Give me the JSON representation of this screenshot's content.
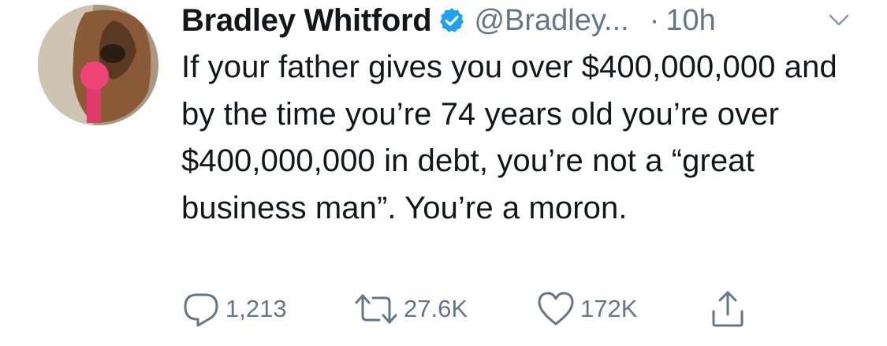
{
  "tweet": {
    "display_name": "Bradley Whitford",
    "handle": "@Bradley...",
    "dot": "·",
    "time": "10h",
    "text": "If your father gives you over $400,000,000 and by the time you’re 74 years old you’re over $400,000,000 in debt, you’re not a “great business man”. You’re a moron."
  },
  "actions": {
    "reply": {
      "icon": "reply-icon",
      "count": "1,213"
    },
    "retweet": {
      "icon": "retweet-icon",
      "count": "27.6K"
    },
    "like": {
      "icon": "heart-icon",
      "count": "172K"
    },
    "share": {
      "icon": "share-icon"
    }
  },
  "colors": {
    "text": "#14171a",
    "secondary": "#657786",
    "verified": "#1da1f2"
  }
}
